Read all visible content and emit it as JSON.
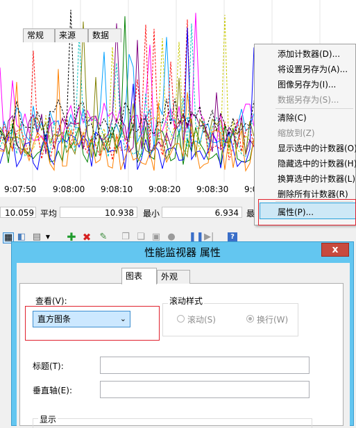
{
  "chart": {
    "time_ticks": [
      "9:07:50",
      "9:08:00",
      "9:08:10",
      "9:08:20",
      "9:08:30",
      "9:0"
    ],
    "series_colors": [
      "#c8c800",
      "#ff00ff",
      "#00a0ff",
      "#ff0000",
      "#008000",
      "#0000ff",
      "#00c0c0",
      "#800080",
      "#ff8000",
      "#000000",
      "#808000"
    ]
  },
  "stats": {
    "left_value": "10.059",
    "avg_label": "平均",
    "avg_value": "10.938",
    "min_label": "最小",
    "min_value": "6.934",
    "max_label_partial": "最"
  },
  "context_menu": {
    "items": [
      {
        "label": "添加计数器(D)...",
        "disabled": false
      },
      {
        "label": "将设置另存为(A)...",
        "disabled": false
      },
      {
        "label": "图像另存为(I)...",
        "disabled": false
      },
      {
        "label": "数据另存为(S)...",
        "disabled": true
      },
      {
        "label": "清除(C)",
        "disabled": false
      },
      {
        "label": "缩放到(Z)",
        "disabled": true
      },
      {
        "label": "显示选中的计数器(O)",
        "disabled": false
      },
      {
        "label": "隐藏选中的计数器(H)",
        "disabled": false
      },
      {
        "label": "换算选中的计数器(L)",
        "disabled": false
      },
      {
        "label": "删除所有计数器(R)",
        "disabled": false
      },
      {
        "label": "属性(P)...",
        "disabled": false,
        "highlighted": true
      }
    ]
  },
  "dialog": {
    "title": "性能监视器 属性",
    "close_glyph": "x",
    "tabs": [
      "常规",
      "来源",
      "数据",
      "图表",
      "外观"
    ],
    "active_tab": "图表",
    "view_label": "查看(V):",
    "view_value": "直方图条",
    "scroll_style_label": "滚动样式",
    "scroll_option": "滚动(S)",
    "wrap_option": "换行(W)",
    "title_label": "标题(T):",
    "title_value": "",
    "vaxis_label": "垂直轴(E):",
    "vaxis_value": "",
    "display_label": "显示"
  }
}
